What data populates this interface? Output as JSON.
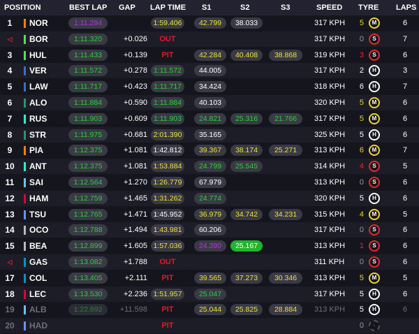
{
  "header": {
    "position": "POSITION",
    "best_lap": "BEST LAP",
    "gap": "GAP",
    "lap_time": "LAP TIME",
    "s1": "S1",
    "s2": "S2",
    "s3": "S3",
    "speed": "SPEED",
    "tyre": "TYRE",
    "laps": "LAPS"
  },
  "colors": {
    "purple": "#b138dd",
    "green": "#2ecf3b",
    "yellow": "#f0e13a",
    "white": "#ffffff",
    "pit": "#e8152b",
    "soft": "#e52a2a",
    "medium": "#f3d22a",
    "hard": "#ffffff"
  },
  "rows": [
    {
      "pos": "1",
      "driver": "NOR",
      "team": "#ff8000",
      "best": "1:11.294",
      "best_c": "purple",
      "gap": "",
      "lt": "1:59.406",
      "lt_c": "yellow",
      "s1": "42.799",
      "s1_c": "yellow",
      "s2": "38.033",
      "s2_c": "white",
      "s3": "",
      "s3_c": "",
      "speed": "317 KPH",
      "tl": "5",
      "tyre": "M",
      "laps": "6"
    },
    {
      "pos": "◁",
      "driver": "BOR",
      "team": "#52e252",
      "best": "1:11.320",
      "best_c": "green",
      "gap": "+0.026",
      "lt": "OUT",
      "lt_c": "pit",
      "s1": "",
      "s1_c": "",
      "s2": "",
      "s2_c": "",
      "s3": "",
      "s3_c": "",
      "speed": "317 KPH",
      "tl": "0",
      "tyre": "S",
      "laps": "7"
    },
    {
      "pos": "3",
      "driver": "HUL",
      "team": "#52e252",
      "best": "1:11.433",
      "best_c": "green",
      "gap": "+0.139",
      "lt": "PIT",
      "lt_c": "pit",
      "s1": "42.284",
      "s1_c": "yellow",
      "s2": "40.408",
      "s2_c": "yellow",
      "s3": "38.868",
      "s3_c": "yellow",
      "speed": "319 KPH",
      "tl": "3",
      "tyre": "S",
      "laps": "6"
    },
    {
      "pos": "4",
      "driver": "VER",
      "team": "#3671c6",
      "best": "1:11.572",
      "best_c": "green",
      "gap": "+0.278",
      "lt": "1:11.572",
      "lt_c": "green",
      "s1": "44.005",
      "s1_c": "white",
      "s2": "",
      "s2_c": "",
      "s3": "",
      "s3_c": "",
      "speed": "317 KPH",
      "tl": "2",
      "tyre": "H",
      "laps": "3"
    },
    {
      "pos": "5",
      "driver": "LAW",
      "team": "#3671c6",
      "best": "1:11.717",
      "best_c": "green",
      "gap": "+0.423",
      "lt": "1:11.717",
      "lt_c": "green",
      "s1": "34.424",
      "s1_c": "white",
      "s2": "",
      "s2_c": "",
      "s3": "",
      "s3_c": "",
      "speed": "318 KPH",
      "tl": "6",
      "tyre": "H",
      "laps": "7"
    },
    {
      "pos": "6",
      "driver": "ALO",
      "team": "#229971",
      "best": "1:11.884",
      "best_c": "green",
      "gap": "+0.590",
      "lt": "1:11.884",
      "lt_c": "green",
      "s1": "40.103",
      "s1_c": "white",
      "s2": "",
      "s2_c": "",
      "s3": "",
      "s3_c": "",
      "speed": "320 KPH",
      "tl": "5",
      "tyre": "M",
      "laps": "6"
    },
    {
      "pos": "7",
      "driver": "RUS",
      "team": "#27f4d2",
      "best": "1:11.903",
      "best_c": "green",
      "gap": "+0.609",
      "lt": "1:11.903",
      "lt_c": "green",
      "s1": "24.821",
      "s1_c": "green",
      "s2": "25.316",
      "s2_c": "green",
      "s3": "21.766",
      "s3_c": "green",
      "speed": "317 KPH",
      "tl": "5",
      "tyre": "M",
      "laps": "6"
    },
    {
      "pos": "8",
      "driver": "STR",
      "team": "#229971",
      "best": "1:11.975",
      "best_c": "green",
      "gap": "+0.681",
      "lt": "2:01.390",
      "lt_c": "yellow",
      "s1": "35.165",
      "s1_c": "white",
      "s2": "",
      "s2_c": "",
      "s3": "",
      "s3_c": "",
      "speed": "325 KPH",
      "tl": "5",
      "tyre": "H",
      "laps": "6"
    },
    {
      "pos": "9",
      "driver": "PIA",
      "team": "#ff8000",
      "best": "1:12.375",
      "best_c": "green",
      "gap": "+1.081",
      "lt": "1:42.812",
      "lt_c": "white",
      "s1": "39.367",
      "s1_c": "yellow",
      "s2": "38.174",
      "s2_c": "yellow",
      "s3": "25.271",
      "s3_c": "yellow",
      "speed": "313 KPH",
      "tl": "6",
      "tyre": "M",
      "laps": "7"
    },
    {
      "pos": "10",
      "driver": "ANT",
      "team": "#27f4d2",
      "best": "1:12.375",
      "best_c": "green",
      "gap": "+1.081",
      "lt": "1:53.884",
      "lt_c": "yellow",
      "s1": "24.799",
      "s1_c": "green",
      "s2": "25.545",
      "s2_c": "green",
      "s3": "",
      "s3_c": "",
      "speed": "314 KPH",
      "tl": "4",
      "tyre": "S",
      "laps": "5"
    },
    {
      "pos": "11",
      "driver": "SAI",
      "team": "#64c4ff",
      "best": "1:12.564",
      "best_c": "green",
      "gap": "+1.270",
      "lt": "1:26.779",
      "lt_c": "yellow",
      "s1": "67.979",
      "s1_c": "white",
      "s2": "",
      "s2_c": "",
      "s3": "",
      "s3_c": "",
      "speed": "313 KPH",
      "tl": "0",
      "tyre": "S",
      "laps": "6"
    },
    {
      "pos": "12",
      "driver": "HAM",
      "team": "#e8002d",
      "best": "1:12.759",
      "best_c": "green",
      "gap": "+1.465",
      "lt": "1:31.262",
      "lt_c": "yellow",
      "s1": "24.774",
      "s1_c": "green",
      "s2": "",
      "s2_c": "",
      "s3": "",
      "s3_c": "",
      "speed": "320 KPH",
      "tl": "5",
      "tyre": "H",
      "laps": "6"
    },
    {
      "pos": "13",
      "driver": "TSU",
      "team": "#6692ff",
      "best": "1:12.765",
      "best_c": "green",
      "gap": "+1.471",
      "lt": "1:45.952",
      "lt_c": "white",
      "s1": "36.979",
      "s1_c": "yellow",
      "s2": "34.742",
      "s2_c": "yellow",
      "s3": "34.231",
      "s3_c": "yellow",
      "speed": "315 KPH",
      "tl": "4",
      "tyre": "M",
      "laps": "5"
    },
    {
      "pos": "14",
      "driver": "OCO",
      "team": "#b6babd",
      "best": "1:12.788",
      "best_c": "green",
      "gap": "+1.494",
      "lt": "1:43.981",
      "lt_c": "yellow",
      "s1": "60.206",
      "s1_c": "white",
      "s2": "",
      "s2_c": "",
      "s3": "",
      "s3_c": "",
      "speed": "317 KPH",
      "tl": "0",
      "tyre": "S",
      "laps": "6"
    },
    {
      "pos": "15",
      "driver": "BEA",
      "team": "#b6babd",
      "best": "1:12.899",
      "best_c": "green",
      "gap": "+1.605",
      "lt": "1:57.036",
      "lt_c": "yellow",
      "s1": "24.390",
      "s1_c": "purple",
      "s2": "25.167",
      "s2_c": "greenfill",
      "s3": "",
      "s3_c": "",
      "speed": "313 KPH",
      "tl": "1",
      "tyre": "S",
      "laps": "6"
    },
    {
      "pos": "◁",
      "driver": "GAS",
      "team": "#0093cc",
      "best": "1:13.082",
      "best_c": "green",
      "gap": "+1.788",
      "lt": "OUT",
      "lt_c": "pit",
      "s1": "",
      "s1_c": "",
      "s2": "",
      "s2_c": "",
      "s3": "",
      "s3_c": "",
      "speed": "311 KPH",
      "tl": "0",
      "tyre": "S",
      "laps": "6"
    },
    {
      "pos": "17",
      "driver": "COL",
      "team": "#0093cc",
      "best": "1:13.405",
      "best_c": "green",
      "gap": "+2.111",
      "lt": "PIT",
      "lt_c": "pit",
      "s1": "39.565",
      "s1_c": "yellow",
      "s2": "37.273",
      "s2_c": "yellow",
      "s3": "30.346",
      "s3_c": "yellow",
      "speed": "313 KPH",
      "tl": "5",
      "tyre": "M",
      "laps": "5"
    },
    {
      "pos": "18",
      "driver": "LEC",
      "team": "#e8002d",
      "best": "1:13.530",
      "best_c": "green",
      "gap": "+2.236",
      "lt": "1:51.957",
      "lt_c": "yellow",
      "s1": "25.047",
      "s1_c": "green",
      "s2": "",
      "s2_c": "",
      "s3": "",
      "s3_c": "",
      "speed": "317 KPH",
      "tl": "5",
      "tyre": "H",
      "laps": "6"
    },
    {
      "pos": "19",
      "driver": "ALB",
      "team": "#64c4ff",
      "best": "1:22.892",
      "best_c": "green",
      "gap": "+11.598",
      "lt": "PIT",
      "lt_c": "pit",
      "s1": "25.044",
      "s1_c": "yellow",
      "s2": "25.825",
      "s2_c": "yellow",
      "s3": "28.884",
      "s3_c": "yellow",
      "speed": "313 KPH",
      "tl": "5",
      "tyre": "H",
      "laps": "6"
    },
    {
      "pos": "20",
      "driver": "HAD",
      "team": "#6692ff",
      "best": "",
      "best_c": "",
      "gap": "",
      "lt": "PIT",
      "lt_c": "pit",
      "s1": "",
      "s1_c": "",
      "s2": "",
      "s2_c": "",
      "s3": "",
      "s3_c": "",
      "speed": "",
      "tl": "0",
      "tyre": "-",
      "laps": ""
    }
  ]
}
